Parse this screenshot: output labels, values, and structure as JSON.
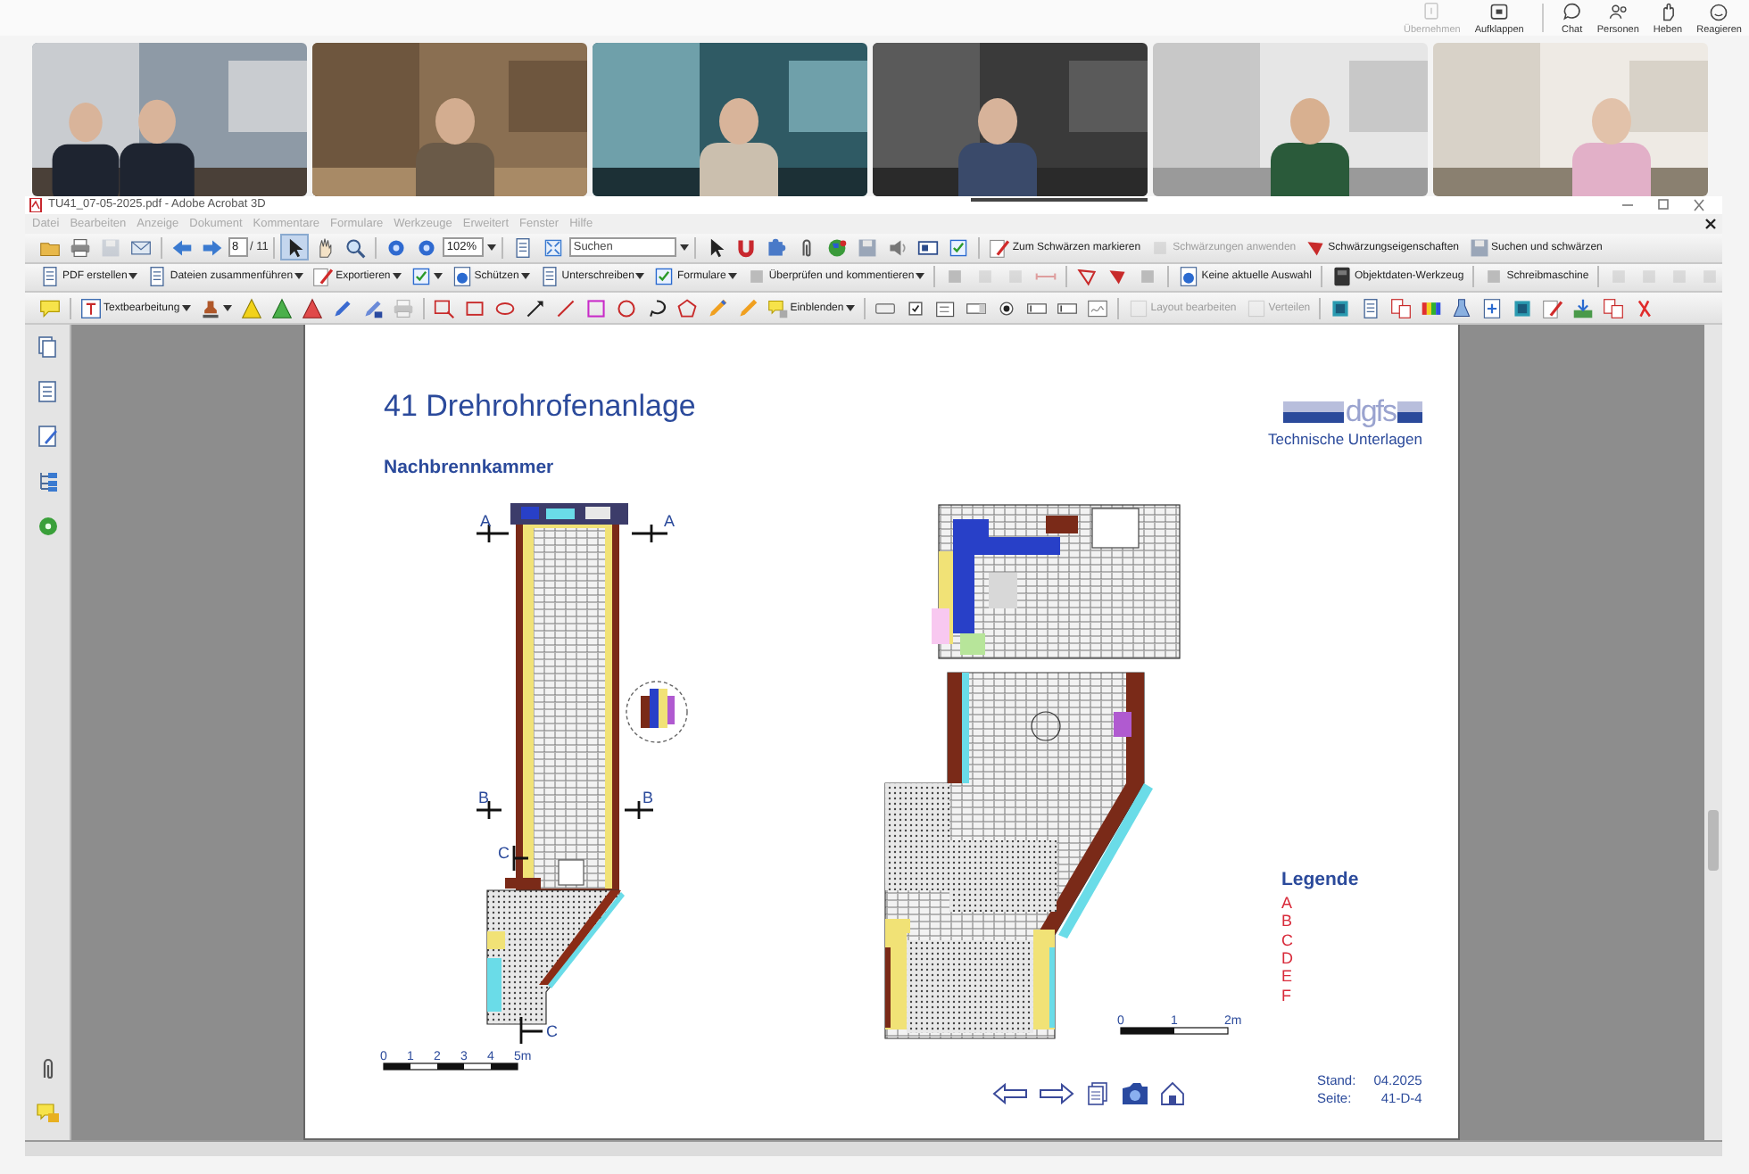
{
  "meeting_bar": {
    "buttons": [
      {
        "label": "Übernehmen",
        "disabled": true
      },
      {
        "label": "Aufklappen",
        "disabled": false
      },
      {
        "label": "Chat",
        "disabled": false
      },
      {
        "label": "Personen",
        "disabled": false
      },
      {
        "label": "Heben",
        "disabled": false
      },
      {
        "label": "Reagieren",
        "disabled": false
      }
    ]
  },
  "video_tiles": [
    {
      "kind": "picture",
      "speaking": false
    },
    {
      "kind": "picture",
      "speaking": false
    },
    {
      "kind": "picture",
      "speaking": false
    },
    {
      "kind": "picture",
      "speaking": true
    },
    {
      "kind": "picture",
      "speaking": false
    },
    {
      "kind": "picture",
      "speaking": false
    }
  ],
  "window": {
    "title": "TU41_07-05-2025.pdf - Adobe Acrobat 3D"
  },
  "menu": [
    {
      "label": "Datei"
    },
    {
      "label": "Bearbeiten"
    },
    {
      "label": "Anzeige"
    },
    {
      "label": "Dokument"
    },
    {
      "label": "Kommentare"
    },
    {
      "label": "Formulare"
    },
    {
      "label": "Werkzeuge"
    },
    {
      "label": "Erweitert"
    },
    {
      "label": "Fenster"
    },
    {
      "label": "Hilfe"
    }
  ],
  "toolbars": [
    {
      "items": [
        {
          "kind": "icon"
        },
        {
          "kind": "icon"
        },
        {
          "kind": "icon",
          "disabled": true
        },
        {
          "kind": "icon"
        },
        {
          "kind": "separator"
        },
        {
          "kind": "icon"
        },
        {
          "kind": "icon"
        },
        {
          "kind": "field",
          "value": "8"
        },
        {
          "kind": "text",
          "label": "/ 11"
        },
        {
          "kind": "separator"
        },
        {
          "kind": "icon",
          "selected": true
        },
        {
          "kind": "icon",
          "selected": false
        },
        {
          "kind": "icon",
          "selected": false
        },
        {
          "kind": "separator"
        },
        {
          "kind": "icon"
        },
        {
          "kind": "icon"
        },
        {
          "kind": "field",
          "value": "102%",
          "dropdown": true
        },
        {
          "kind": "separator"
        },
        {
          "kind": "icon"
        },
        {
          "kind": "icon"
        },
        {
          "kind": "field",
          "placeholder": "Suchen",
          "dropdown": true,
          "wide": true
        },
        {
          "kind": "separator"
        },
        {
          "kind": "icon"
        },
        {
          "kind": "icon"
        },
        {
          "kind": "icon"
        },
        {
          "kind": "icon"
        },
        {
          "kind": "icon"
        },
        {
          "kind": "icon"
        },
        {
          "kind": "icon"
        },
        {
          "kind": "icon"
        },
        {
          "kind": "icon"
        },
        {
          "kind": "separator"
        },
        {
          "kind": "button",
          "label": "Zum Schwärzen markieren"
        },
        {
          "kind": "button",
          "label": "Schwärzungen anwenden",
          "disabled": true
        },
        {
          "kind": "button",
          "label": "Schwärzungseigenschaften"
        },
        {
          "kind": "button",
          "label": "Suchen und schwärzen"
        }
      ]
    },
    {
      "items": [
        {
          "kind": "button",
          "label": "PDF erstellen",
          "dropdown": true
        },
        {
          "kind": "button",
          "label": "Dateien zusammenführen",
          "dropdown": true
        },
        {
          "kind": "button",
          "label": "Exportieren",
          "dropdown": true
        },
        {
          "kind": "icon",
          "dropdown": true
        },
        {
          "kind": "button",
          "label": "Schützen",
          "dropdown": true
        },
        {
          "kind": "button",
          "label": "Unterschreiben",
          "dropdown": true
        },
        {
          "kind": "button",
          "label": "Formulare",
          "dropdown": true
        },
        {
          "kind": "button",
          "label": "Überprüfen und kommentieren",
          "dropdown": true
        },
        {
          "kind": "separator"
        },
        {
          "kind": "icon"
        },
        {
          "kind": "icon",
          "disabled": true
        },
        {
          "kind": "icon",
          "disabled": true
        },
        {
          "kind": "icon",
          "disabled": true
        },
        {
          "kind": "separator"
        },
        {
          "kind": "icon"
        },
        {
          "kind": "icon"
        },
        {
          "kind": "icon"
        },
        {
          "kind": "separator"
        },
        {
          "kind": "button",
          "label": "Keine aktuelle Auswahl"
        },
        {
          "kind": "separator"
        },
        {
          "kind": "button",
          "label": "Objektdaten-Werkzeug"
        },
        {
          "kind": "separator"
        },
        {
          "kind": "button",
          "label": "Schreibmaschine"
        },
        {
          "kind": "separator"
        },
        {
          "kind": "icon",
          "disabled": true
        },
        {
          "kind": "icon",
          "disabled": true
        },
        {
          "kind": "icon",
          "disabled": true
        },
        {
          "kind": "icon",
          "disabled": true
        }
      ]
    },
    {
      "items": [
        {
          "kind": "icon"
        },
        {
          "kind": "separator"
        },
        {
          "kind": "button",
          "label": "Textbearbeitung",
          "dropdown": true
        },
        {
          "kind": "icon",
          "dropdown": true
        },
        {
          "kind": "icon"
        },
        {
          "kind": "icon"
        },
        {
          "kind": "icon"
        },
        {
          "kind": "icon"
        },
        {
          "kind": "icon"
        },
        {
          "kind": "icon",
          "disabled": true
        },
        {
          "kind": "separator"
        },
        {
          "kind": "icon"
        },
        {
          "kind": "icon"
        },
        {
          "kind": "icon"
        },
        {
          "kind": "icon"
        },
        {
          "kind": "icon"
        },
        {
          "kind": "icon"
        },
        {
          "kind": "icon"
        },
        {
          "kind": "icon"
        },
        {
          "kind": "icon"
        },
        {
          "kind": "icon"
        },
        {
          "kind": "icon"
        },
        {
          "kind": "button",
          "label": "Einblenden",
          "dropdown": true
        },
        {
          "kind": "separator"
        },
        {
          "kind": "icon"
        },
        {
          "kind": "icon"
        },
        {
          "kind": "icon"
        },
        {
          "kind": "icon"
        },
        {
          "kind": "icon"
        },
        {
          "kind": "icon"
        },
        {
          "kind": "icon"
        },
        {
          "kind": "icon"
        },
        {
          "kind": "separator"
        },
        {
          "kind": "button",
          "label": "Layout bearbeiten",
          "disabled": true
        },
        {
          "kind": "button",
          "label": "Verteilen",
          "disabled": true
        },
        {
          "kind": "separator"
        },
        {
          "kind": "icon"
        },
        {
          "kind": "icon"
        },
        {
          "kind": "icon"
        },
        {
          "kind": "icon"
        },
        {
          "kind": "icon"
        },
        {
          "kind": "icon"
        },
        {
          "kind": "icon"
        },
        {
          "kind": "icon"
        },
        {
          "kind": "icon"
        },
        {
          "kind": "icon"
        },
        {
          "kind": "icon"
        }
      ]
    }
  ],
  "page": {
    "title": "41 Drehrohrofenanlage",
    "logo": "dgfs",
    "logo_caption": "Technische Unterlagen",
    "subtitle": "Nachbrennkammer",
    "left_drawing": {
      "section_labels": [
        "A",
        "A",
        "B",
        "B",
        "C",
        "C"
      ],
      "scale_labels": [
        "0",
        "1",
        "2",
        "3",
        "4",
        "5m"
      ]
    },
    "right_drawing": {
      "scale_labels": [
        "0",
        "1",
        "2m"
      ]
    },
    "legend": {
      "title": "Legende",
      "items": [
        "A",
        "B",
        "C",
        "D",
        "E",
        "F"
      ]
    },
    "info": [
      {
        "label": "Stand:",
        "value": "04.2025"
      },
      {
        "label": "Seite:",
        "value": "41-D-4"
      }
    ]
  }
}
